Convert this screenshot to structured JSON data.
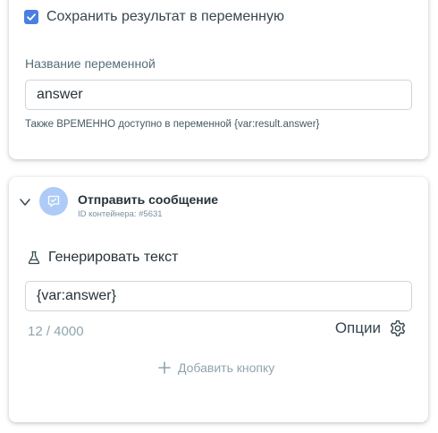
{
  "save_block": {
    "checkbox_checked": true,
    "checkbox_label": "Сохранить результат в переменную",
    "variable_name_label": "Название переменной",
    "variable_name_value": "answer",
    "hint": "Также ВРЕМЕННО доступно в переменной {var:result.answer}"
  },
  "step": {
    "title": "Отправить сообщение",
    "container_id": "ID контейнера: #5631",
    "generate_label": "Генерировать текст",
    "message_value": "{var:answer}",
    "char_counter": "12 / 4000",
    "options_label": "Опции",
    "add_button_label": "Добавить кнопку"
  },
  "icons": {
    "checkbox": "check-icon",
    "collapse": "chevron-down-icon",
    "step_avatar": "message-check-icon",
    "generate": "flask-icon",
    "options": "gear-icon",
    "add": "plus-icon"
  },
  "colors": {
    "accent": "#4a7fe0",
    "avatar_bg": "#aecbf7",
    "muted_text": "#90a4ae"
  }
}
